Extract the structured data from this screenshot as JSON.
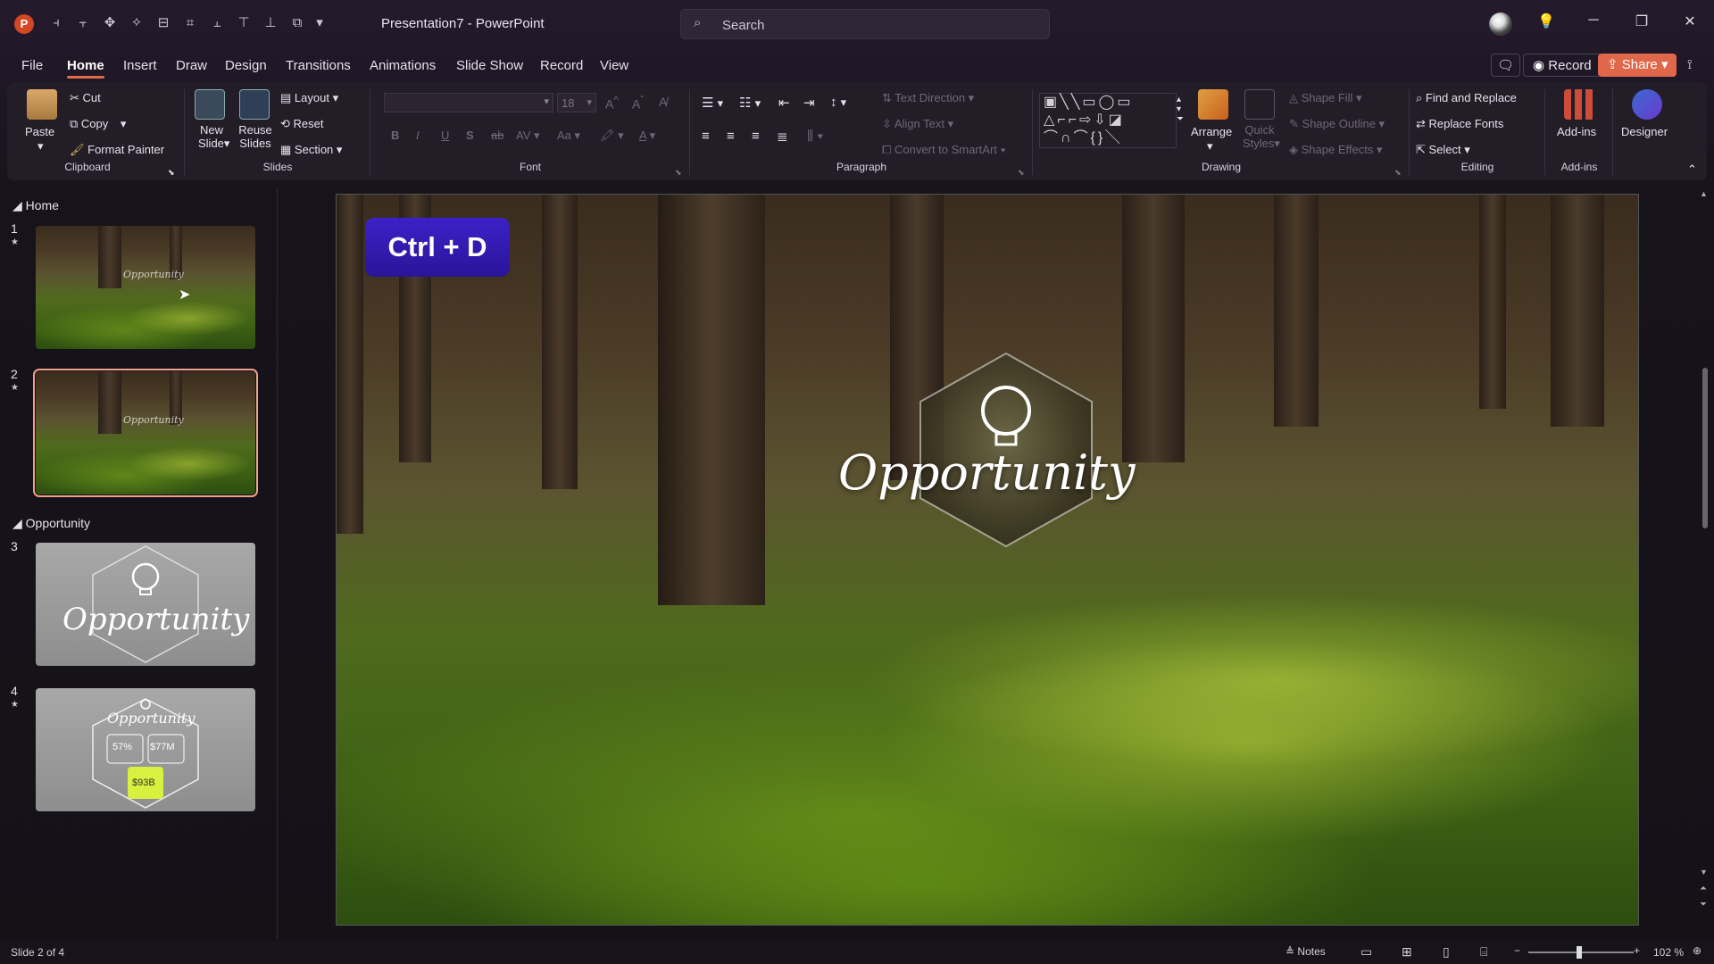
{
  "titlebar": {
    "title": "Presentation7  -  PowerPoint",
    "search_placeholder": "Search"
  },
  "menu": {
    "items": [
      "File",
      "Home",
      "Insert",
      "Draw",
      "Design",
      "Transitions",
      "Animations",
      "Slide Show",
      "Record",
      "View"
    ]
  },
  "header_buttons": {
    "record": "Record",
    "share": "Share"
  },
  "ribbon": {
    "clipboard": {
      "paste": "Paste",
      "cut": "Cut",
      "copy": "Copy",
      "format_painter": "Format Painter",
      "label": "Clipboard"
    },
    "slides": {
      "new_slide_1": "New",
      "new_slide_2": "Slide",
      "reuse_1": "Reuse",
      "reuse_2": "Slides",
      "layout": "Layout",
      "reset": "Reset",
      "section": "Section",
      "label": "Slides"
    },
    "font": {
      "size": "18",
      "label": "Font",
      "b": "B",
      "i": "I",
      "u": "U",
      "s": "S",
      "abc": "ab",
      "spacing": "AV",
      "case": "Aa",
      "color_a": "A"
    },
    "paragraph": {
      "text_direction": "Text Direction",
      "align_text": "Align Text",
      "convert_smartart": "Convert to SmartArt",
      "label": "Paragraph"
    },
    "drawing": {
      "arrange": "Arrange",
      "quick_1": "Quick",
      "quick_2": "Styles",
      "shape_fill": "Shape Fill",
      "shape_outline": "Shape Outline",
      "shape_effects": "Shape Effects",
      "label": "Drawing"
    },
    "editing": {
      "find_replace": "Find and Replace",
      "replace_fonts": "Replace Fonts",
      "select": "Select",
      "label": "Editing"
    },
    "addins": {
      "addins": "Add-ins",
      "label": "Add-ins"
    },
    "designer": {
      "label": "Designer"
    }
  },
  "slides_panel": {
    "section_home": "Home",
    "section_opportunity": "Opportunity",
    "numbers": [
      "1",
      "2",
      "3",
      "4"
    ],
    "thumb_text": "Opportunity",
    "thumb4": {
      "title": "Opportunity",
      "stat1": "57%",
      "stat2": "$77M",
      "stat3": "$93B"
    }
  },
  "slide": {
    "shortcut_badge": "Ctrl + D",
    "headline": "Opportunity"
  },
  "status": {
    "slide_info": "Slide 2 of 4",
    "notes": "Notes",
    "zoom": "102 %"
  }
}
